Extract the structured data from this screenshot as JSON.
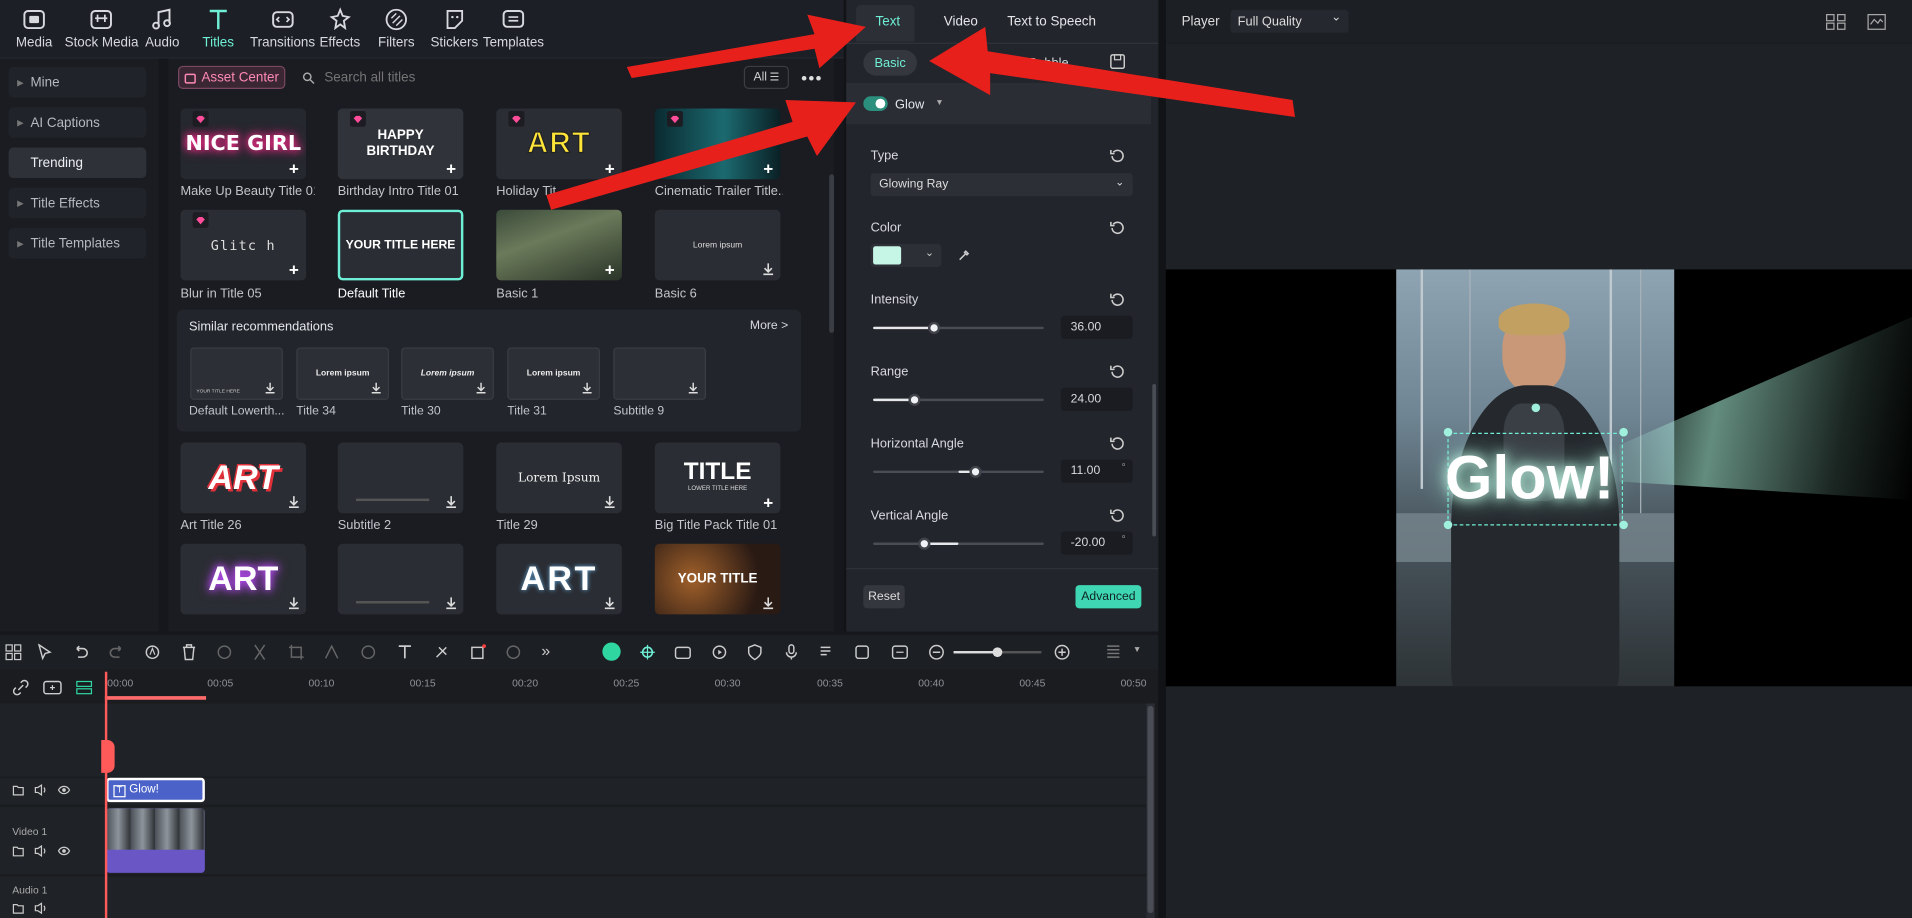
{
  "toolbar": {
    "items": [
      {
        "label": "Media",
        "icon": "media-icon"
      },
      {
        "label": "Stock Media",
        "icon": "stock-media-icon"
      },
      {
        "label": "Audio",
        "icon": "audio-icon"
      },
      {
        "label": "Titles",
        "icon": "titles-icon"
      },
      {
        "label": "Transitions",
        "icon": "transitions-icon"
      },
      {
        "label": "Effects",
        "icon": "effects-icon"
      },
      {
        "label": "Filters",
        "icon": "filters-icon"
      },
      {
        "label": "Stickers",
        "icon": "stickers-icon"
      },
      {
        "label": "Templates",
        "icon": "templates-icon"
      }
    ],
    "active": "Titles",
    "accent": "#6ff0d6"
  },
  "sidebar": {
    "items": [
      {
        "label": "Mine"
      },
      {
        "label": "AI Captions"
      },
      {
        "label": "Trending"
      },
      {
        "label": "Title Effects"
      },
      {
        "label": "Title Templates"
      }
    ],
    "active": "Trending"
  },
  "browser": {
    "asset_center": "Asset Center",
    "search_placeholder": "Search all titles",
    "filter": "All",
    "row1": [
      {
        "label": "Make Up Beauty Title 01",
        "thumb": "NICE GIRL"
      },
      {
        "label": "Birthday Intro Title 01",
        "thumb": "HAPPY BIRTHDAY"
      },
      {
        "label": "Holiday Tit",
        "thumb": "ART"
      },
      {
        "label": "Cinematic Trailer Title...",
        "thumb": ""
      }
    ],
    "row2": [
      {
        "label": "Blur in Title 05",
        "thumb": "Glitc h"
      },
      {
        "label": "Default Title",
        "thumb": "YOUR TITLE HERE"
      },
      {
        "label": "Basic 1",
        "thumb": ""
      },
      {
        "label": "Basic 6",
        "thumb": "Lorem ipsum"
      }
    ],
    "similar": {
      "title": "Similar recommendations",
      "more": "More >",
      "items": [
        {
          "label": "Default Lowerth...",
          "thumb": "YOUR TITLE HERE"
        },
        {
          "label": "Title 34",
          "thumb": "Lorem ipsum"
        },
        {
          "label": "Title 30",
          "thumb": "Lorem ipsum"
        },
        {
          "label": "Title 31",
          "thumb": "Lorem ipsum"
        },
        {
          "label": "Subtitle 9",
          "thumb": ""
        }
      ]
    },
    "row3": [
      {
        "label": "Art Title 26",
        "thumb": "ART"
      },
      {
        "label": "Subtitle 2",
        "thumb": ""
      },
      {
        "label": "Title 29",
        "thumb": "Lorem Ipsum"
      },
      {
        "label": "Big Title Pack Title 01",
        "thumb": "TITLE",
        "sub": "LOWER TITLE HERE"
      }
    ],
    "row4": [
      {
        "thumb": "ART"
      },
      {
        "thumb": ""
      },
      {
        "thumb": "ART"
      },
      {
        "thumb": "YOUR TITLE"
      }
    ]
  },
  "properties": {
    "tabs": [
      "Text",
      "Video",
      "Text to Speech"
    ],
    "subtabs": [
      "Basic",
      "n",
      "Bubble"
    ],
    "glow_label": "Glow",
    "type_label": "Type",
    "type_value": "Glowing Ray",
    "color_label": "Color",
    "glow_color": "#c6f6e6",
    "intensity_label": "Intensity",
    "intensity_value": "36.00",
    "intensity_level": 0.36,
    "range_label": "Range",
    "range_value": "24.00",
    "range_level": 0.24,
    "h_angle_label": "Horizontal Angle",
    "h_angle_value": "11.00",
    "h_angle_level": 0.6,
    "v_angle_label": "Vertical Angle",
    "v_angle_value": "-20.00",
    "v_angle_level": 0.3,
    "deg": "°",
    "reset": "Reset",
    "advanced": "Advanced"
  },
  "player": {
    "label": "Player",
    "quality": "Full Quality",
    "overlay_text": "Glow!"
  },
  "timeline": {
    "ticks": [
      "00:00",
      "00:05",
      "00:10",
      "00:15",
      "00:20",
      "00:25",
      "00:30",
      "00:35",
      "00:40",
      "00:45",
      "00:50"
    ],
    "title_clip": "Glow!",
    "video_track": "Video 1",
    "audio_track": "Audio 1"
  }
}
